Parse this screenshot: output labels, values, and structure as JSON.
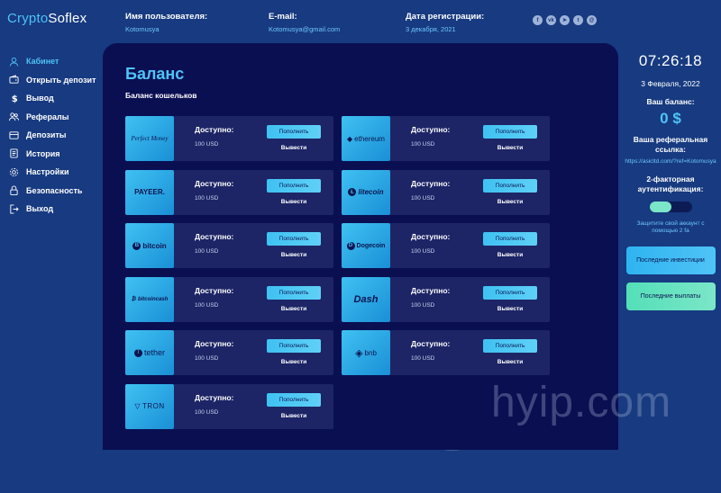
{
  "logo": {
    "part1": "Crypto",
    "part2": "Soflex"
  },
  "header": {
    "username_label": "Имя пользователя:",
    "username": "Kotomusya",
    "email_label": "E-mail:",
    "email": "Kotomusya@gmail.com",
    "reg_label": "Дата регистрации:",
    "reg_date": "3 декабря, 2021",
    "socials": [
      {
        "icon": "facebook-icon",
        "glyph": "f"
      },
      {
        "icon": "vk-icon",
        "glyph": "vk"
      },
      {
        "icon": "telegram-icon",
        "glyph": "➤"
      },
      {
        "icon": "twitter-icon",
        "glyph": "t"
      },
      {
        "icon": "email-icon",
        "glyph": "@"
      }
    ]
  },
  "sidebar": {
    "items": [
      {
        "label": "Кабинет",
        "icon": "user-icon",
        "active": true
      },
      {
        "label": "Открыть депозит",
        "icon": "wallet-icon",
        "active": false
      },
      {
        "label": "Вывод",
        "icon": "dollar-icon",
        "active": false
      },
      {
        "label": "Рефералы",
        "icon": "users-icon",
        "active": false
      },
      {
        "label": "Депозиты",
        "icon": "deposits-icon",
        "active": false
      },
      {
        "label": "История",
        "icon": "history-icon",
        "active": false
      },
      {
        "label": "Настройки",
        "icon": "settings-icon",
        "active": false
      },
      {
        "label": "Безопасность",
        "icon": "lock-icon",
        "active": false
      },
      {
        "label": "Выход",
        "icon": "logout-icon",
        "active": false
      }
    ]
  },
  "main": {
    "title": "Баланс",
    "subtitle": "Баланс кошельков",
    "wallets": [
      {
        "brand": "Perfect Money",
        "brand_icon": "perfect-money-logo",
        "available_label": "Доступно:",
        "amount": "100 USD",
        "fill_label": "Пополнить",
        "withdraw_label": "Вывести"
      },
      {
        "brand": "ethereum",
        "brand_icon": "ethereum-logo",
        "available_label": "Доступно:",
        "amount": "100 USD",
        "fill_label": "Пополнить",
        "withdraw_label": "Вывести"
      },
      {
        "brand": "PAYEER.",
        "brand_icon": "payeer-logo",
        "available_label": "Доступно:",
        "amount": "100 USD",
        "fill_label": "Пополнить",
        "withdraw_label": "Вывести"
      },
      {
        "brand": "litecoin",
        "brand_icon": "litecoin-logo",
        "available_label": "Доступно:",
        "amount": "100 USD",
        "fill_label": "Пополнить",
        "withdraw_label": "Вывести"
      },
      {
        "brand": "bitcoin",
        "brand_icon": "bitcoin-logo",
        "available_label": "Доступно:",
        "amount": "100 USD",
        "fill_label": "Пополнить",
        "withdraw_label": "Вывести"
      },
      {
        "brand": "Dogecoin",
        "brand_icon": "dogecoin-logo",
        "available_label": "Доступно:",
        "amount": "100 USD",
        "fill_label": "Пополнить",
        "withdraw_label": "Вывести"
      },
      {
        "brand": "bitcoincash",
        "brand_icon": "bitcoincash-logo",
        "available_label": "Доступно:",
        "amount": "100 USD",
        "fill_label": "Пополнить",
        "withdraw_label": "Вывести"
      },
      {
        "brand": "Dash",
        "brand_icon": "dash-logo",
        "available_label": "Доступно:",
        "amount": "100 USD",
        "fill_label": "Пополнить",
        "withdraw_label": "Вывести"
      },
      {
        "brand": "tether",
        "brand_icon": "tether-logo",
        "available_label": "Доступно:",
        "amount": "100 USD",
        "fill_label": "Пополнить",
        "withdraw_label": "Вывести"
      },
      {
        "brand": "bnb",
        "brand_icon": "bnb-logo",
        "available_label": "Доступно:",
        "amount": "100 USD",
        "fill_label": "Пополнить",
        "withdraw_label": "Вывести"
      },
      {
        "brand": "TRON",
        "brand_icon": "tron-logo",
        "available_label": "Доступно:",
        "amount": "100 USD",
        "fill_label": "Пополнить",
        "withdraw_label": "Вывести"
      }
    ]
  },
  "right": {
    "time": "07:26:18",
    "date": "3 Февраля, 2022",
    "balance_label": "Ваш баланс:",
    "balance_value": "0 $",
    "ref_label": "Ваша реферальная ссылка:",
    "ref_link": "https://asicltd.com/?ref=Kotomusya",
    "tfa_label": "2-факторная аутентификация:",
    "tfa_enabled": false,
    "tfa_note": "Защитите свой аккаунт с помощью 2 fa",
    "last_investments": "Последние инвестиции",
    "last_payouts": "Последние выплаты"
  },
  "watermark": {
    "text": "hyip.com"
  },
  "colors": {
    "background": "#173a80",
    "panel": "#0a0f52",
    "card": "#1d2566",
    "accent": "#4fc3f7",
    "green": "#7be6c8"
  }
}
